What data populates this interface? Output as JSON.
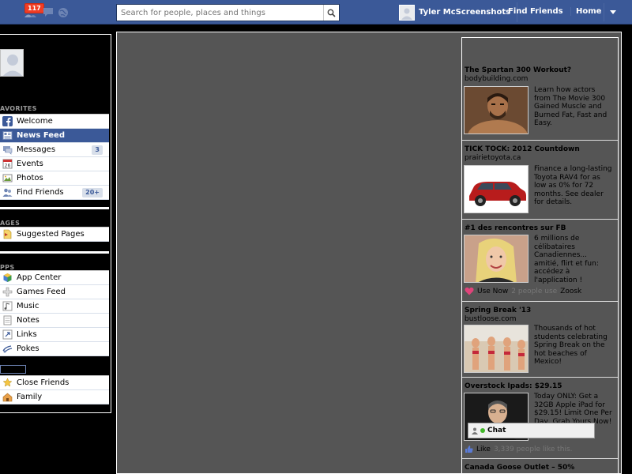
{
  "topbar": {
    "notif_count": "117",
    "search_placeholder": "Search for people, places and things",
    "profile_name": "Tyler McScreenshots",
    "find_friends": "Find Friends",
    "home": "Home"
  },
  "left": {
    "favorites_heading": "AVORITES",
    "favorites": [
      {
        "label": "Welcome",
        "icon": "facebook-icon"
      },
      {
        "label": "News Feed",
        "icon": "news-feed-icon"
      },
      {
        "label": "Messages",
        "icon": "messages-icon",
        "count": "3"
      },
      {
        "label": "Events",
        "icon": "calendar-icon"
      },
      {
        "label": "Photos",
        "icon": "photos-icon"
      },
      {
        "label": "Find Friends",
        "icon": "friends-icon",
        "count": "20+"
      }
    ],
    "pages_heading": "AGES",
    "pages": [
      {
        "label": "Suggested Pages",
        "icon": "pages-icon"
      }
    ],
    "apps_heading": "PPS",
    "apps": [
      {
        "label": "App Center",
        "icon": "app-center-icon"
      },
      {
        "label": "Games Feed",
        "icon": "games-icon"
      },
      {
        "label": "Music",
        "icon": "music-icon"
      },
      {
        "label": "Notes",
        "icon": "notes-icon"
      },
      {
        "label": "Links",
        "icon": "links-icon"
      },
      {
        "label": "Pokes",
        "icon": "pokes-icon"
      }
    ],
    "lists": [
      {
        "label": "Close Friends",
        "icon": "star-icon"
      },
      {
        "label": "Family",
        "icon": "family-icon"
      }
    ]
  },
  "ads": [
    {
      "title": "The Spartan 300 Workout?",
      "domain": "bodybuilding.com",
      "text": "Learn how actors from The Movie 300 Gained Muscle and Burned Fat, Fast and Easy."
    },
    {
      "title": "TICK TOCK: 2012 Countdown",
      "domain": "prairietoyota.ca",
      "text": "Finance a long-lasting Toyota RAV4 for as low as 0% for 72 months. See dealer for details."
    },
    {
      "title": "#1 des rencontres sur FB",
      "domain": "",
      "text": "6 millions de célibataires Canadiennes... amitié, flirt et fun: accédez à l'application !",
      "social_action": "Use Now",
      "social_count": "2 people use",
      "social_app": "Zoosk"
    },
    {
      "title": "Spring Break '13",
      "domain": "bustloose.com",
      "text": "Thousands of hot students celebrating Spring Break on the hot beaches of Mexico!"
    },
    {
      "title": "Overstock Ipads: $29.15",
      "domain": "",
      "text": "Today ONLY: Get a 32GB Apple iPad for $29.15! Limit One Per Day, Grab Yours Now!",
      "social_action": "Like",
      "social_count": "3,339 people like this."
    },
    {
      "title": "Canada Goose Outlet – 50%",
      "domain": "",
      "text": ""
    }
  ],
  "chat": {
    "label": "Chat"
  },
  "colors": {
    "brand": "#3b5998",
    "badge": "#f03d25",
    "background": "#000000",
    "main": "#555555"
  }
}
